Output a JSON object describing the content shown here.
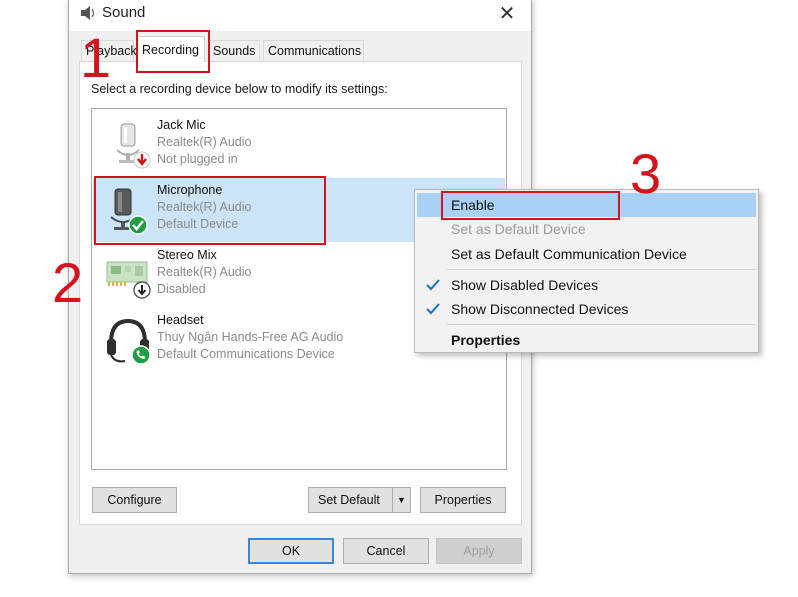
{
  "window": {
    "title": "Sound",
    "close_icon": "close-icon"
  },
  "tabs": [
    {
      "label": "Playback"
    },
    {
      "label": "Recording"
    },
    {
      "label": "Sounds"
    },
    {
      "label": "Communications"
    }
  ],
  "instruction": "Select a recording device below to modify its settings:",
  "devices": [
    {
      "name": "Jack Mic",
      "driver": "Realtek(R) Audio",
      "status": "Not plugged in",
      "icon": "microphone-icon",
      "badge": "unplugged-badge"
    },
    {
      "name": "Microphone",
      "driver": "Realtek(R) Audio",
      "status": "Default Device",
      "icon": "microphone-icon",
      "badge": "default-check-badge"
    },
    {
      "name": "Stereo Mix",
      "driver": "Realtek(R) Audio",
      "status": "Disabled",
      "icon": "sound-card-icon",
      "badge": "disabled-arrow-badge"
    },
    {
      "name": "Headset",
      "driver": "Thuy Ngân Hands-Free AG Audio",
      "status": "Default Communications Device",
      "icon": "headset-icon",
      "badge": "phone-badge"
    }
  ],
  "buttons": {
    "configure": "Configure",
    "set_default": "Set Default",
    "properties": "Properties",
    "ok": "OK",
    "cancel": "Cancel",
    "apply": "Apply"
  },
  "context_menu": {
    "items": [
      {
        "label": "Enable",
        "state": "highlighted"
      },
      {
        "label": "Set as Default Device",
        "state": "disabled"
      },
      {
        "label": "Set as Default Communication Device",
        "state": "normal"
      },
      {
        "label": "Show Disabled Devices",
        "state": "checked"
      },
      {
        "label": "Show Disconnected Devices",
        "state": "checked"
      },
      {
        "label": "Properties",
        "state": "bold"
      }
    ]
  },
  "annotations": {
    "step1": "1",
    "step2": "2",
    "step3": "3"
  },
  "colors": {
    "annotation_red": "#d4141c",
    "selection_blue": "#cce4f7",
    "menu_highlight": "#a9d0f5"
  }
}
